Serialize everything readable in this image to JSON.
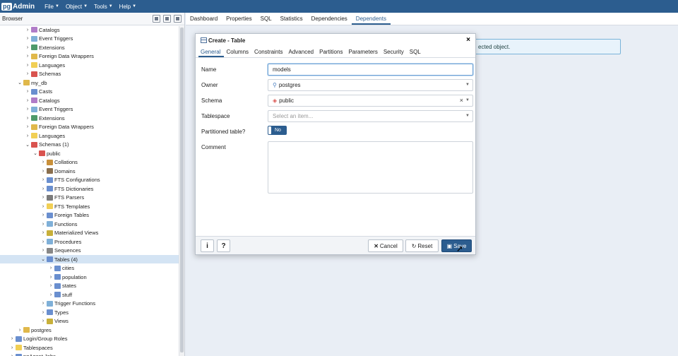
{
  "menubar": {
    "logo_badge": "pg",
    "logo_text": "Admin",
    "items": [
      "File",
      "Object",
      "Tools",
      "Help"
    ]
  },
  "browser": {
    "title": "Browser",
    "tree": [
      {
        "label": "Catalogs",
        "indent": 3,
        "arrow": ">",
        "color": "#b07cc8"
      },
      {
        "label": "Event Triggers",
        "indent": 3,
        "arrow": ">",
        "color": "#7fb0d8"
      },
      {
        "label": "Extensions",
        "indent": 3,
        "arrow": ">",
        "color": "#4e9a6a"
      },
      {
        "label": "Foreign Data Wrappers",
        "indent": 3,
        "arrow": ">",
        "color": "#e0b84a"
      },
      {
        "label": "Languages",
        "indent": 3,
        "arrow": ">",
        "color": "#f1cf55"
      },
      {
        "label": "Schemas",
        "indent": 3,
        "arrow": ">",
        "color": "#d9534f"
      },
      {
        "label": "my_db",
        "indent": 2,
        "arrow": "v",
        "color": "#e0b84a"
      },
      {
        "label": "Casts",
        "indent": 3,
        "arrow": ">",
        "color": "#6a8fcf"
      },
      {
        "label": "Catalogs",
        "indent": 3,
        "arrow": ">",
        "color": "#b07cc8"
      },
      {
        "label": "Event Triggers",
        "indent": 3,
        "arrow": ">",
        "color": "#7fb0d8"
      },
      {
        "label": "Extensions",
        "indent": 3,
        "arrow": ">",
        "color": "#4e9a6a"
      },
      {
        "label": "Foreign Data Wrappers",
        "indent": 3,
        "arrow": ">",
        "color": "#e0b84a"
      },
      {
        "label": "Languages",
        "indent": 3,
        "arrow": ">",
        "color": "#f1cf55"
      },
      {
        "label": "Schemas (1)",
        "indent": 3,
        "arrow": "v",
        "color": "#d9534f"
      },
      {
        "label": "public",
        "indent": 4,
        "arrow": "v",
        "color": "#d9534f"
      },
      {
        "label": "Collations",
        "indent": 5,
        "arrow": ">",
        "color": "#c9903a"
      },
      {
        "label": "Domains",
        "indent": 5,
        "arrow": ">",
        "color": "#8a6f4e"
      },
      {
        "label": "FTS Configurations",
        "indent": 5,
        "arrow": ">",
        "color": "#6a8fcf"
      },
      {
        "label": "FTS Dictionaries",
        "indent": 5,
        "arrow": ">",
        "color": "#6a8fcf"
      },
      {
        "label": "FTS Parsers",
        "indent": 5,
        "arrow": ">",
        "color": "#7b7b7b"
      },
      {
        "label": "FTS Templates",
        "indent": 5,
        "arrow": ">",
        "color": "#f1cf55"
      },
      {
        "label": "Foreign Tables",
        "indent": 5,
        "arrow": ">",
        "color": "#6a8fcf"
      },
      {
        "label": "Functions",
        "indent": 5,
        "arrow": ">",
        "color": "#7fb0d8"
      },
      {
        "label": "Materialized Views",
        "indent": 5,
        "arrow": ">",
        "color": "#c8b03a"
      },
      {
        "label": "Procedures",
        "indent": 5,
        "arrow": ">",
        "color": "#7fb0d8"
      },
      {
        "label": "Sequences",
        "indent": 5,
        "arrow": ">",
        "color": "#888888"
      },
      {
        "label": "Tables (4)",
        "indent": 5,
        "arrow": "v",
        "color": "#6a8fcf",
        "selected": true
      },
      {
        "label": "cities",
        "indent": 6,
        "arrow": ">",
        "color": "#6a8fcf"
      },
      {
        "label": "population",
        "indent": 6,
        "arrow": ">",
        "color": "#6a8fcf"
      },
      {
        "label": "states",
        "indent": 6,
        "arrow": ">",
        "color": "#6a8fcf"
      },
      {
        "label": "stuff",
        "indent": 6,
        "arrow": ">",
        "color": "#6a8fcf"
      },
      {
        "label": "Trigger Functions",
        "indent": 5,
        "arrow": ">",
        "color": "#7fb0d8"
      },
      {
        "label": "Types",
        "indent": 5,
        "arrow": ">",
        "color": "#6a8fcf"
      },
      {
        "label": "Views",
        "indent": 5,
        "arrow": ">",
        "color": "#c8b03a"
      },
      {
        "label": "postgres",
        "indent": 2,
        "arrow": ">",
        "color": "#e0b84a"
      },
      {
        "label": "Login/Group Roles",
        "indent": 1,
        "arrow": ">",
        "color": "#6a8fcf"
      },
      {
        "label": "Tablespaces",
        "indent": 1,
        "arrow": ">",
        "color": "#f1cf55"
      },
      {
        "label": "pgAgent Jobs",
        "indent": 1,
        "arrow": ">",
        "color": "#6a8fcf"
      }
    ]
  },
  "main_tabs": [
    "Dashboard",
    "Properties",
    "SQL",
    "Statistics",
    "Dependencies",
    "Dependents"
  ],
  "info_text": "ected object.",
  "dialog": {
    "title": "Create - Table",
    "close_glyph": "×",
    "tabs": [
      "General",
      "Columns",
      "Constraints",
      "Advanced",
      "Partitions",
      "Parameters",
      "Security",
      "SQL"
    ],
    "name_label": "Name",
    "name_value": "models",
    "owner_label": "Owner",
    "owner_value": "postgres",
    "schema_label": "Schema",
    "schema_value": "public",
    "schema_clear": "×",
    "tablespace_label": "Tablespace",
    "tablespace_placeholder": "Select an item...",
    "partitioned_label": "Partitioned table?",
    "partitioned_value": "No",
    "comment_label": "Comment",
    "info_button": "i",
    "help_button": "?",
    "cancel_label": "Cancel",
    "reset_label": "Reset",
    "save_label": "Save"
  }
}
